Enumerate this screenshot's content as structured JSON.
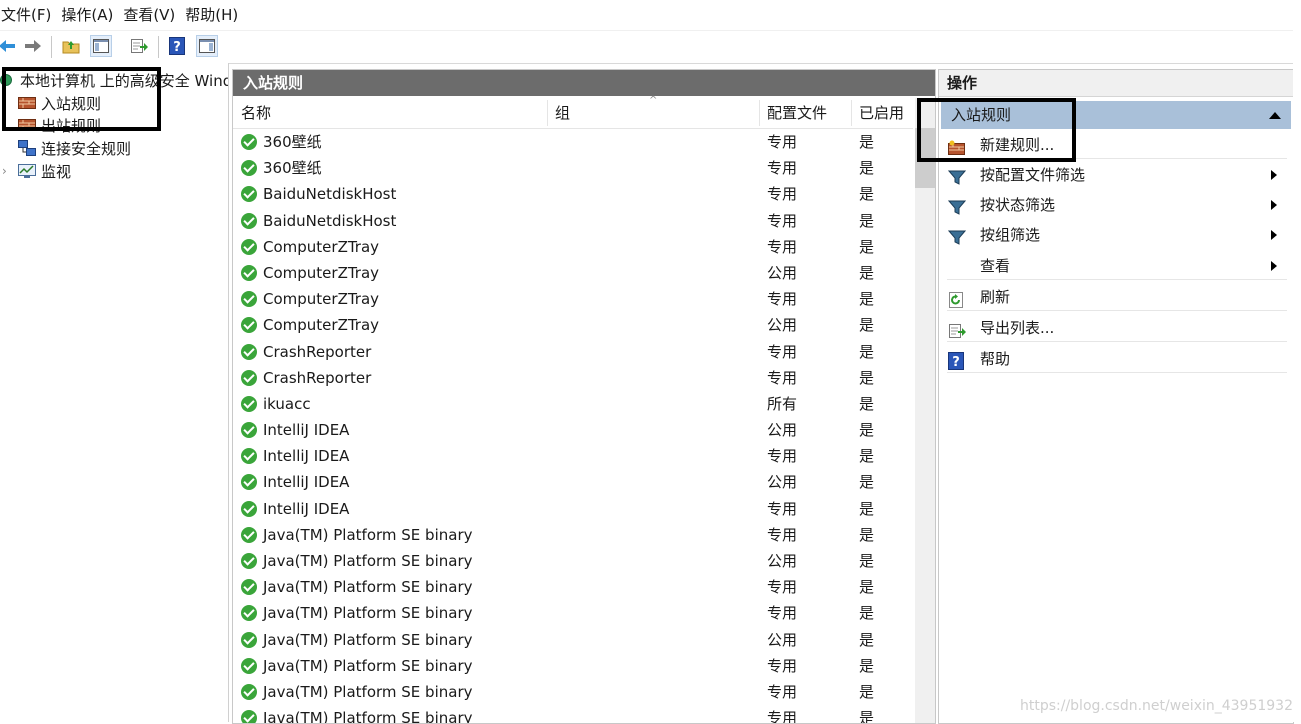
{
  "menubar": {
    "items": [
      "文件(F)",
      "操作(A)",
      "查看(V)",
      "帮助(H)"
    ]
  },
  "toolbar": {
    "buttons": [
      "back-icon",
      "forward-icon",
      "up-folder-icon",
      "show-hide-tree-icon",
      "export-list-icon",
      "help-icon",
      "properties-pane-icon"
    ]
  },
  "tree": {
    "root": "本地计算机 上的高级安全 Windows",
    "items": [
      "入站规则",
      "出站规则",
      "连接安全规则",
      "监视"
    ]
  },
  "middle": {
    "title": "入站规则",
    "columns": {
      "name": "名称",
      "group": "组",
      "profile": "配置文件",
      "enabled": "已启用"
    },
    "rows": [
      {
        "name": "360壁纸",
        "profile": "专用",
        "enabled": "是"
      },
      {
        "name": "360壁纸",
        "profile": "专用",
        "enabled": "是"
      },
      {
        "name": "BaiduNetdiskHost",
        "profile": "专用",
        "enabled": "是"
      },
      {
        "name": "BaiduNetdiskHost",
        "profile": "专用",
        "enabled": "是"
      },
      {
        "name": "ComputerZTray",
        "profile": "专用",
        "enabled": "是"
      },
      {
        "name": "ComputerZTray",
        "profile": "公用",
        "enabled": "是"
      },
      {
        "name": "ComputerZTray",
        "profile": "专用",
        "enabled": "是"
      },
      {
        "name": "ComputerZTray",
        "profile": "公用",
        "enabled": "是"
      },
      {
        "name": "CrashReporter",
        "profile": "专用",
        "enabled": "是"
      },
      {
        "name": "CrashReporter",
        "profile": "专用",
        "enabled": "是"
      },
      {
        "name": "ikuacc",
        "profile": "所有",
        "enabled": "是"
      },
      {
        "name": "IntelliJ IDEA",
        "profile": "公用",
        "enabled": "是"
      },
      {
        "name": "IntelliJ IDEA",
        "profile": "专用",
        "enabled": "是"
      },
      {
        "name": "IntelliJ IDEA",
        "profile": "公用",
        "enabled": "是"
      },
      {
        "name": "IntelliJ IDEA",
        "profile": "专用",
        "enabled": "是"
      },
      {
        "name": "Java(TM) Platform SE binary",
        "profile": "专用",
        "enabled": "是"
      },
      {
        "name": "Java(TM) Platform SE binary",
        "profile": "公用",
        "enabled": "是"
      },
      {
        "name": "Java(TM) Platform SE binary",
        "profile": "专用",
        "enabled": "是"
      },
      {
        "name": "Java(TM) Platform SE binary",
        "profile": "专用",
        "enabled": "是"
      },
      {
        "name": "Java(TM) Platform SE binary",
        "profile": "公用",
        "enabled": "是"
      },
      {
        "name": "Java(TM) Platform SE binary",
        "profile": "专用",
        "enabled": "是"
      },
      {
        "name": "Java(TM) Platform SE binary",
        "profile": "专用",
        "enabled": "是"
      },
      {
        "name": "Java(TM) Platform SE binary",
        "profile": "专用",
        "enabled": "是"
      }
    ]
  },
  "actions": {
    "title": "操作",
    "group": "入站规则",
    "items": [
      {
        "label": "新建规则...",
        "icon": "new-rule-icon",
        "submenu": false
      },
      {
        "label": "按配置文件筛选",
        "icon": "filter-icon",
        "submenu": true
      },
      {
        "label": "按状态筛选",
        "icon": "filter-icon",
        "submenu": true
      },
      {
        "label": "按组筛选",
        "icon": "filter-icon",
        "submenu": true
      },
      {
        "label": "查看",
        "icon": "",
        "submenu": true
      },
      {
        "label": "刷新",
        "icon": "refresh-icon",
        "submenu": false
      },
      {
        "label": "导出列表...",
        "icon": "export-list-icon",
        "submenu": false
      },
      {
        "label": "帮助",
        "icon": "help-icon",
        "submenu": false
      }
    ]
  },
  "watermark": "https://blog.csdn.net/weixin_43951932",
  "colors": {
    "pane_header": "#6c6c6c",
    "group_header": "#a9c0d9",
    "check_green": "#3aa53a"
  }
}
